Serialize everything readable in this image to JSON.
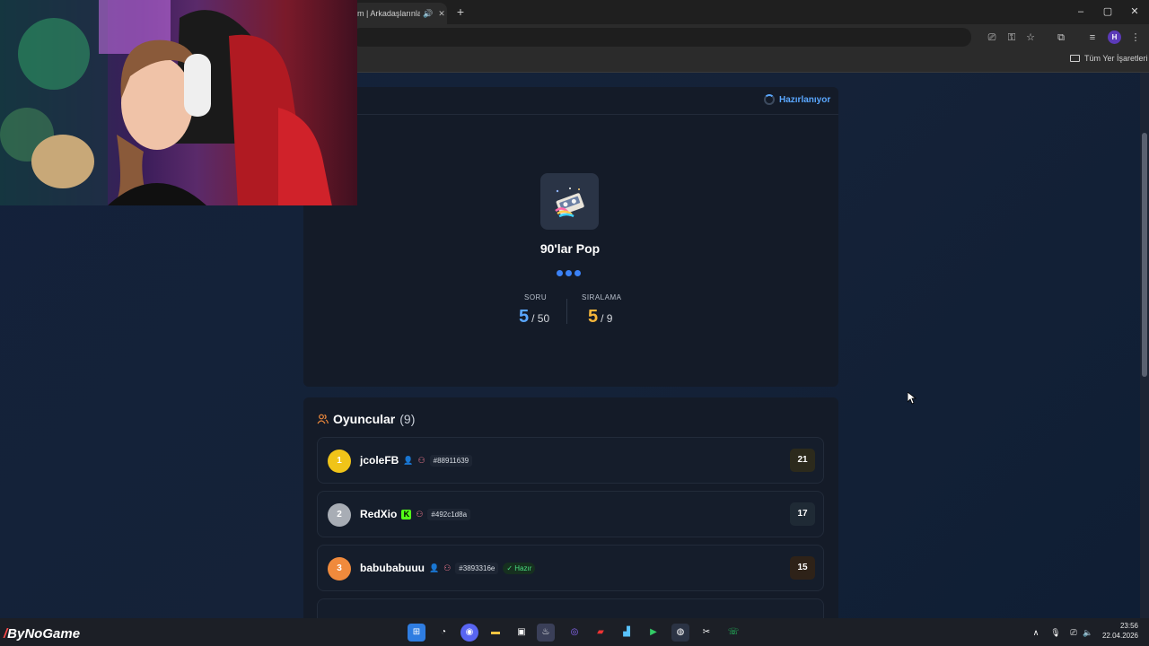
{
  "browser": {
    "tab_title": "m | Arkadaşlarınla",
    "new_tab": "+",
    "window_buttons": [
      "–",
      "▢",
      "✕"
    ],
    "bookmarks_label": "Tüm Yer İşaretleri",
    "profile_initial": "H"
  },
  "game": {
    "status": "Hazırlanıyor",
    "category": "90'lar Pop",
    "question_label": "SORU",
    "question_current": "5",
    "question_total": "/ 50",
    "rank_label": "SIRALAMA",
    "rank_current": "5",
    "rank_total": "/ 9",
    "accent_blue": "#5aa7ff",
    "accent_gold": "#f5b63a"
  },
  "players": {
    "title": "Oyuncular",
    "count": "(9)",
    "list": [
      {
        "rank": "1",
        "name": "jcoleFB",
        "id": "#88911639",
        "ready": "",
        "score": "21",
        "badge_color": "#f0c419"
      },
      {
        "rank": "2",
        "name": "RedXio",
        "id": "#492c1d8a",
        "ready": "",
        "score": "17",
        "badge_color": "#a8adb5"
      },
      {
        "rank": "3",
        "name": "babubabuuu",
        "id": "#3893316e",
        "ready": "Hazır",
        "score": "15",
        "badge_color": "#f08a3c"
      }
    ]
  },
  "taskbar": {
    "brand": "ByNoGame",
    "time": "23:56",
    "date": "22.04.2026"
  }
}
